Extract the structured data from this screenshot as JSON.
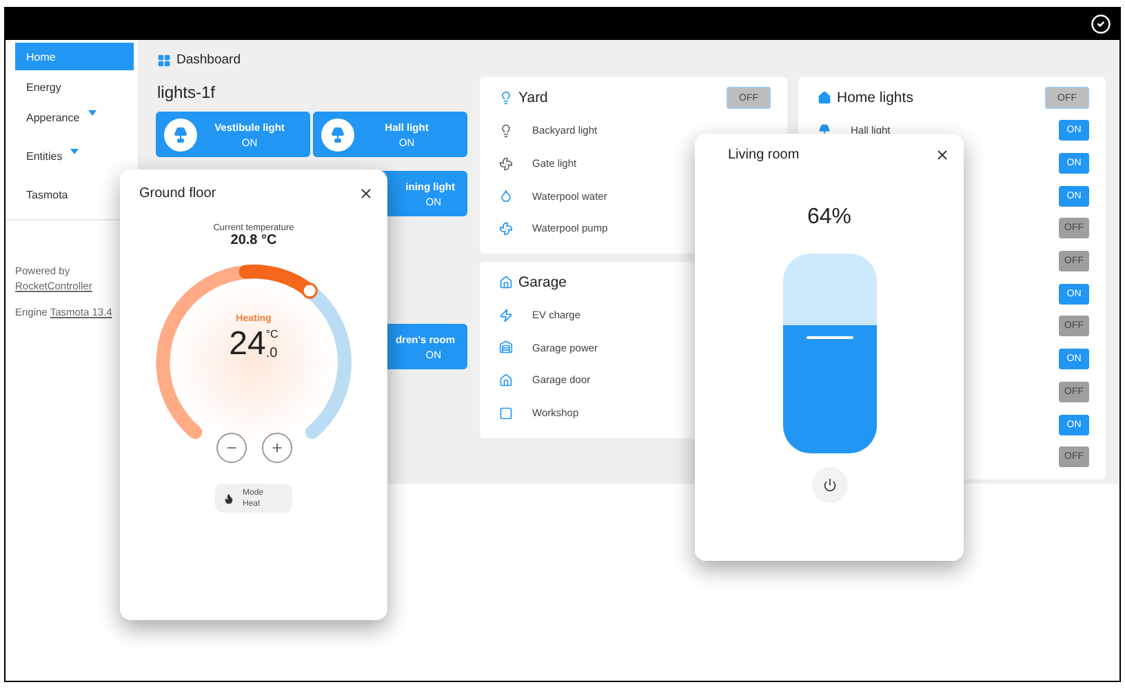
{
  "sidebar": {
    "items": [
      {
        "label": "Home",
        "selected": true,
        "has_submenu": false
      },
      {
        "label": "Energy",
        "selected": false,
        "has_submenu": false
      },
      {
        "label": "Apperance",
        "selected": false,
        "has_submenu": true
      },
      {
        "label": "Entities",
        "selected": false,
        "has_submenu": true
      },
      {
        "label": "Tasmota",
        "selected": false,
        "has_submenu": false
      }
    ],
    "footer": {
      "powered_by": "Powered by",
      "powered_link": "RocketController",
      "engine_label": "Engine",
      "engine_link": "Tasmota 13.4"
    }
  },
  "dashboard": {
    "title": "Dashboard"
  },
  "lights_group": {
    "title": "lights-1f",
    "tiles": [
      {
        "kind": "full",
        "label": "Vestibule light",
        "state": "ON"
      },
      {
        "kind": "full",
        "label": "Hall light",
        "state": "ON"
      },
      {
        "kind": "partial",
        "label": "ining light",
        "state": "ON"
      },
      {
        "kind": "partial",
        "label": "dren's room",
        "state": "ON"
      }
    ]
  },
  "yard": {
    "title": "Yard",
    "toggle": {
      "label": "OFF",
      "on": false
    },
    "rows": [
      {
        "label": "Backyard light"
      },
      {
        "label": "Gate light"
      },
      {
        "label": "Waterpool water"
      },
      {
        "label": "Waterpool pump"
      }
    ]
  },
  "garage": {
    "title": "Garage",
    "rows": [
      {
        "label": "EV charge"
      },
      {
        "label": "Garage power"
      },
      {
        "label": "Garage door"
      },
      {
        "label": "Workshop"
      }
    ]
  },
  "home_lights": {
    "title": "Home lights",
    "toggle": {
      "label": "OFF",
      "on": false
    },
    "rows": [
      {
        "label": "Hall light",
        "toggle": {
          "label": "ON",
          "on": true
        }
      },
      {
        "toggle": {
          "label": "ON",
          "on": true
        }
      },
      {
        "toggle": {
          "label": "ON",
          "on": true
        }
      },
      {
        "toggle": {
          "label": "OFF",
          "on": false
        }
      },
      {
        "toggle": {
          "label": "OFF",
          "on": false
        }
      },
      {
        "toggle": {
          "label": "ON",
          "on": true
        }
      },
      {
        "toggle": {
          "label": "OFF",
          "on": false
        }
      },
      {
        "toggle": {
          "label": "ON",
          "on": true
        }
      },
      {
        "toggle": {
          "label": "OFF",
          "on": false
        }
      },
      {
        "toggle": {
          "label": "ON",
          "on": true
        }
      },
      {
        "toggle": {
          "label": "OFF",
          "on": false
        }
      }
    ]
  },
  "ground_floor_dialog": {
    "title": "Ground floor",
    "current_label": "Current temperature",
    "current_value": "20.8 °C",
    "status": "Heating",
    "target": "24",
    "target_decimal": ".0",
    "unit": "°C",
    "mode_label": "Mode",
    "mode_value": "Heat"
  },
  "living_room_dialog": {
    "title": "Living room",
    "reading": "64%",
    "level": 0.64
  }
}
